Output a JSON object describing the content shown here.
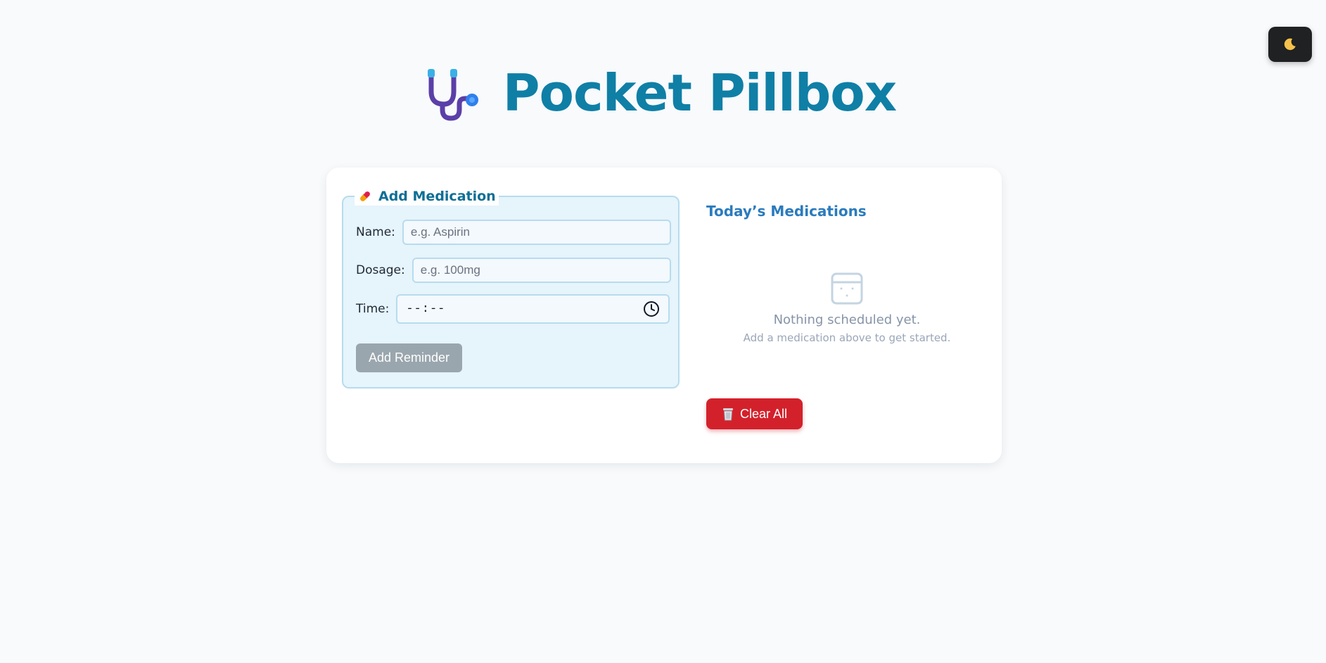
{
  "header": {
    "title": "Pocket Pillbox",
    "logo_icon": "stethoscope-icon"
  },
  "theme_toggle": {
    "icon": "moon-icon"
  },
  "add_form": {
    "legend": "Add Medication",
    "legend_icon": "pill-icon",
    "name_label": "Name:",
    "name_placeholder": "e.g. Aspirin",
    "dosage_label": "Dosage:",
    "dosage_placeholder": "e.g. 100mg",
    "time_label": "Time:",
    "time_value": "--:--",
    "time_icon": "clock-icon",
    "submit_label": "Add Reminder"
  },
  "medications": {
    "title": "Today’s Medications",
    "empty_icon": "calendar-icon",
    "empty_title": "Nothing scheduled yet.",
    "empty_subtitle": "Add a medication above to get started.",
    "clear_label": "Clear All",
    "clear_icon": "trash-icon"
  },
  "colors": {
    "brand": "#0f7fa6",
    "danger": "#d3212b",
    "disabled_button": "#9aa6ad",
    "form_panel_bg": "#e6f4fb"
  }
}
